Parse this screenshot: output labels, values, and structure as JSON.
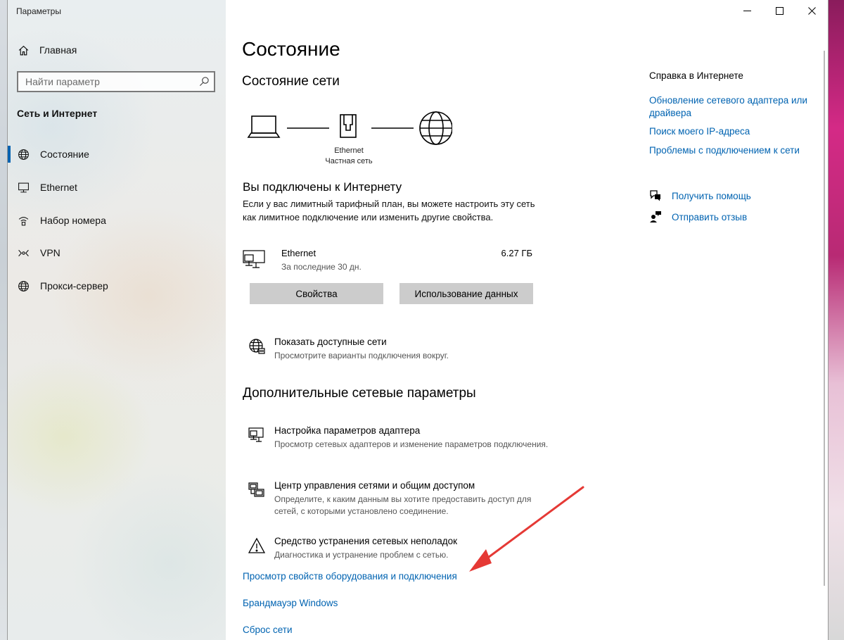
{
  "window": {
    "title": "Параметры"
  },
  "sidebar": {
    "home_label": "Главная",
    "search_placeholder": "Найти параметр",
    "section_title": "Сеть и Интернет",
    "items": [
      {
        "label": "Состояние",
        "icon": "globe-icon",
        "active": true
      },
      {
        "label": "Ethernet",
        "icon": "ethernet-icon",
        "active": false
      },
      {
        "label": "Набор номера",
        "icon": "dialup-icon",
        "active": false
      },
      {
        "label": "VPN",
        "icon": "vpn-icon",
        "active": false
      },
      {
        "label": "Прокси-сервер",
        "icon": "globe-icon",
        "active": false
      }
    ]
  },
  "main": {
    "page_title": "Состояние",
    "network_status_title": "Состояние сети",
    "diagram": {
      "adapter": "Ethernet",
      "network_type": "Частная сеть"
    },
    "connected_title": "Вы подключены к Интернету",
    "connected_desc": "Если у вас лимитный тарифный план, вы можете настроить эту сеть как лимитное подключение или изменить другие свойства.",
    "connection": {
      "name": "Ethernet",
      "period": "За последние 30 дн.",
      "usage": "6.27 ГБ"
    },
    "buttons": {
      "properties": "Свойства",
      "data_usage": "Использование данных"
    },
    "show_networks": {
      "title": "Показать доступные сети",
      "desc": "Просмотрите варианты подключения вокруг."
    },
    "advanced_title": "Дополнительные сетевые параметры",
    "advanced_items": [
      {
        "title": "Настройка параметров адаптера",
        "desc": "Просмотр сетевых адаптеров и изменение параметров подключения."
      },
      {
        "title": "Центр управления сетями и общим доступом",
        "desc": "Определите, к каким данным вы хотите предоставить доступ для сетей, с которыми установлено соединение."
      },
      {
        "title": "Средство устранения сетевых неполадок",
        "desc": "Диагностика и устранение проблем с сетью."
      }
    ],
    "links": [
      "Просмотр свойств оборудования и подключения",
      "Брандмауэр Windows",
      "Сброс сети"
    ]
  },
  "help": {
    "title": "Справка в Интернете",
    "links": [
      "Обновление сетевого адаптера или драйвера",
      "Поиск моего IP-адреса",
      "Проблемы с подключением к сети"
    ],
    "get_help": "Получить помощь",
    "send_feedback": "Отправить отзыв"
  },
  "colors": {
    "accent": "#0063b1",
    "button_bg": "#cccccc",
    "annotation_arrow": "#e53935"
  }
}
